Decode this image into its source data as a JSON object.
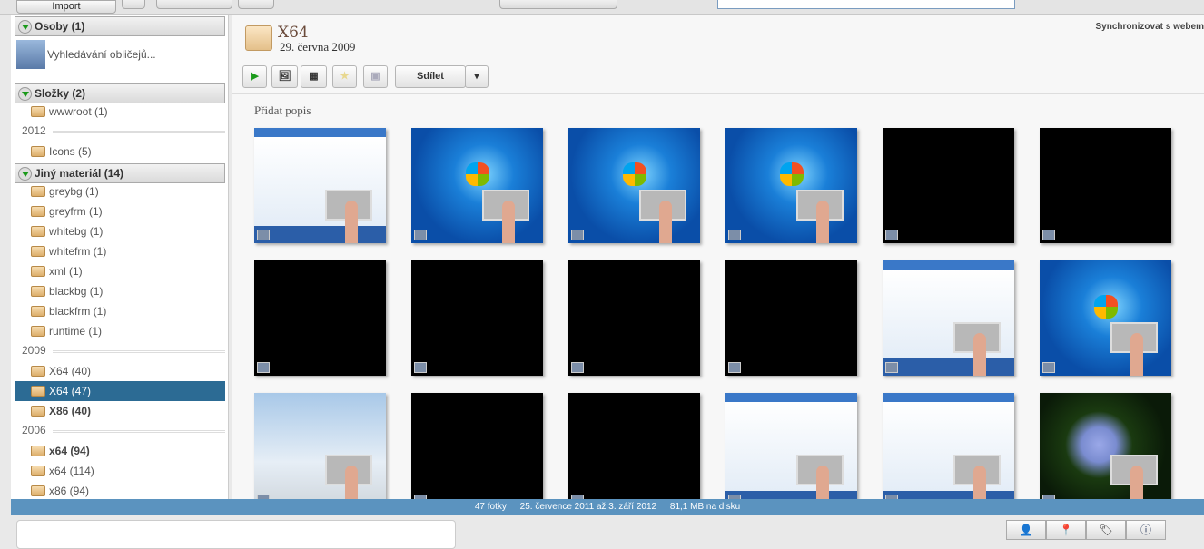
{
  "toolbar": {
    "import_label": "Import",
    "search_placeholder": ""
  },
  "sidebar": {
    "sections": [
      {
        "label": "Osoby (1)"
      },
      {
        "label": "Složky (2)"
      },
      {
        "label": "Jiný materiál (14)"
      }
    ],
    "face_search": "Vyhledávání obličejů...",
    "years": [
      "2012",
      "2009",
      "2006"
    ],
    "items": [
      "wwwroot (1)",
      "Icons (5)",
      "greybg (1)",
      "greyfrm (1)",
      "whitebg (1)",
      "whitefrm (1)",
      "xml (1)",
      "blackbg (1)",
      "blackfrm (1)",
      "runtime (1)",
      "X64 (40)",
      "X64 (47)",
      "X86 (40)",
      "x64 (94)",
      "x64 (114)",
      "x86 (94)"
    ]
  },
  "album": {
    "title": "X64",
    "date": "29. června 2009",
    "share_label": "Sdílet",
    "sync_label": "Synchronizovat s webem",
    "description_placeholder": "Přidat popis"
  },
  "thumbnails": [
    "sheet",
    "win7",
    "win7",
    "win7",
    "black",
    "black",
    "black",
    "black",
    "black",
    "black",
    "sheet",
    "win7",
    "peng",
    "black",
    "black",
    "sheet",
    "sheet",
    "flower"
  ],
  "status": {
    "count": "47 fotky",
    "range": "25. července 2011 až 3. září 2012",
    "size": "81,1 MB na disku"
  },
  "colors": {
    "accent": "#5b93bf",
    "selected": "#2c6b94"
  }
}
